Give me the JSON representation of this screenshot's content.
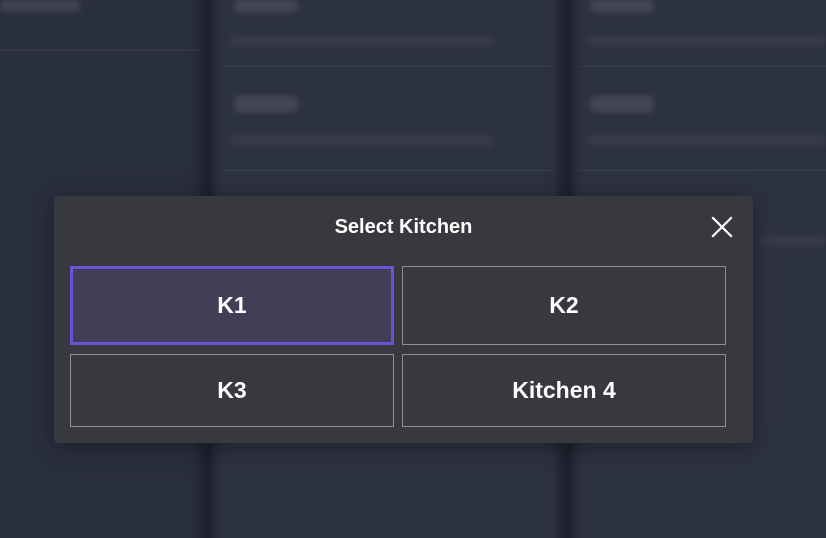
{
  "dialog": {
    "title": "Select Kitchen",
    "close_icon": "close-icon",
    "selected_index": 0,
    "options": [
      {
        "label": "K1",
        "selected": true
      },
      {
        "label": "K2",
        "selected": false
      },
      {
        "label": "K3",
        "selected": false
      },
      {
        "label": "Kitchen 4",
        "selected": false
      }
    ]
  },
  "colors": {
    "modal_background": "#38393e",
    "selected_border": "#6a52d9",
    "selected_background": "#413e56",
    "button_border": "#8e8f94",
    "backdrop": "#262b39"
  }
}
